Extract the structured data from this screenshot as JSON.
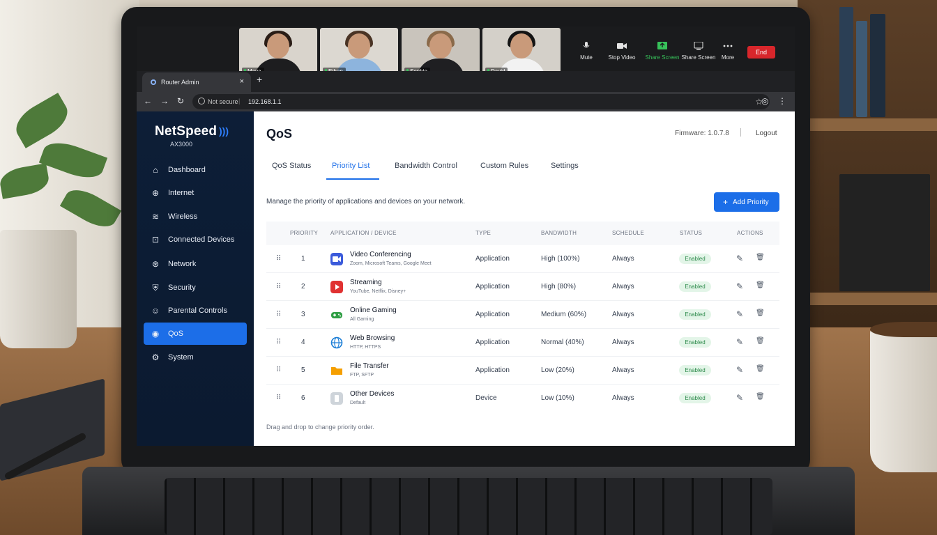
{
  "call": {
    "participants": [
      {
        "name": "Maya",
        "hair": "#2a1d16",
        "shirt": "#1d1d1f",
        "bg": "#d9d4cc"
      },
      {
        "name": "Ethan",
        "hair": "#4a3425",
        "shirt": "#8db4dd",
        "bg": "#dcd8d1"
      },
      {
        "name": "Sophie",
        "hair": "#8a6a4a",
        "shirt": "#1f1f22",
        "bg": "#c9c4bc"
      },
      {
        "name": "David",
        "hair": "#141414",
        "shirt": "#f2f2f2",
        "bg": "#d4d0c9"
      }
    ],
    "controls": {
      "mute": "Mute",
      "stop_video": "Stop Video",
      "share_screen": "Share Screen",
      "share_screen_sub": "Share Screen",
      "more": "More",
      "end": "End"
    }
  },
  "browser": {
    "tab_title": "Router Admin",
    "close_glyph": "×",
    "new_tab_glyph": "+",
    "back_glyph": "←",
    "forward_glyph": "→",
    "reload_glyph": "↻",
    "not_secure": "Not secure",
    "separator": "|",
    "url": "192.168.1.1",
    "star_glyph": "☆",
    "menu_glyph": "⋮"
  },
  "sidebar": {
    "brand": "NetSpeed",
    "brand_mark": ")))",
    "model": "AX3000",
    "items": [
      {
        "label": "Dashboard",
        "icon": "dashboard-icon",
        "glyph": "⌂"
      },
      {
        "label": "Internet",
        "icon": "globe-icon",
        "glyph": "⊕"
      },
      {
        "label": "Wireless",
        "icon": "wifi-icon",
        "glyph": "≋"
      },
      {
        "label": "Connected Devices",
        "icon": "devices-icon",
        "glyph": "⊡"
      },
      {
        "label": "Network",
        "icon": "network-icon",
        "glyph": "⊛"
      },
      {
        "label": "Security",
        "icon": "shield-icon",
        "glyph": "⛨"
      },
      {
        "label": "Parental Controls",
        "icon": "parental-icon",
        "glyph": "☺"
      },
      {
        "label": "QoS",
        "icon": "qos-icon",
        "glyph": "◉",
        "active": true
      },
      {
        "label": "System",
        "icon": "gear-icon",
        "glyph": "⚙"
      }
    ]
  },
  "main": {
    "title": "QoS",
    "firmware": "Firmware: 1.0.7.8",
    "logout": "Logout",
    "tabs": [
      "QoS Status",
      "Priority List",
      "Bandwidth Control",
      "Custom Rules",
      "Settings"
    ],
    "active_tab": "Priority List",
    "description": "Manage the priority of applications and devices on your network.",
    "add_button": "Add Priority",
    "add_glyph": "+",
    "columns": [
      "PRIORITY",
      "APPLICATION / DEVICE",
      "TYPE",
      "BANDWIDTH",
      "SCHEDULE",
      "STATUS",
      "ACTIONS"
    ],
    "rows": [
      {
        "priority": "1",
        "name": "Video Conferencing",
        "sub": "Zoom, Microsoft Teams, Google Meet",
        "type": "Application",
        "bandwidth": "High (100%)",
        "schedule": "Always",
        "status": "Enabled",
        "icon": "video-icon",
        "icon_color": "#3b5bdb"
      },
      {
        "priority": "2",
        "name": "Streaming",
        "sub": "YouTube, Netflix, Disney+",
        "type": "Application",
        "bandwidth": "High (80%)",
        "schedule": "Always",
        "status": "Enabled",
        "icon": "play-icon",
        "icon_color": "#e03131"
      },
      {
        "priority": "3",
        "name": "Online Gaming",
        "sub": "All Gaming",
        "type": "Application",
        "bandwidth": "Medium (60%)",
        "schedule": "Always",
        "status": "Enabled",
        "icon": "gamepad-icon",
        "icon_color": "#2f9e44"
      },
      {
        "priority": "4",
        "name": "Web Browsing",
        "sub": "HTTP, HTTPS",
        "type": "Application",
        "bandwidth": "Normal (40%)",
        "schedule": "Always",
        "status": "Enabled",
        "icon": "globe-icon",
        "icon_color": "#1c7ed6"
      },
      {
        "priority": "5",
        "name": "File Transfer",
        "sub": "FTP, SFTP",
        "type": "Application",
        "bandwidth": "Low (20%)",
        "schedule": "Always",
        "status": "Enabled",
        "icon": "folder-icon",
        "icon_color": "#f59f00"
      },
      {
        "priority": "6",
        "name": "Other Devices",
        "sub": "Default",
        "type": "Device",
        "bandwidth": "Low (10%)",
        "schedule": "Always",
        "status": "Enabled",
        "icon": "device-icon",
        "icon_color": "#adb5bd"
      }
    ],
    "grip_glyph": "⠿",
    "edit_glyph": "✎",
    "delete_glyph": "🗑",
    "footer": "Drag and drop to change priority order."
  }
}
